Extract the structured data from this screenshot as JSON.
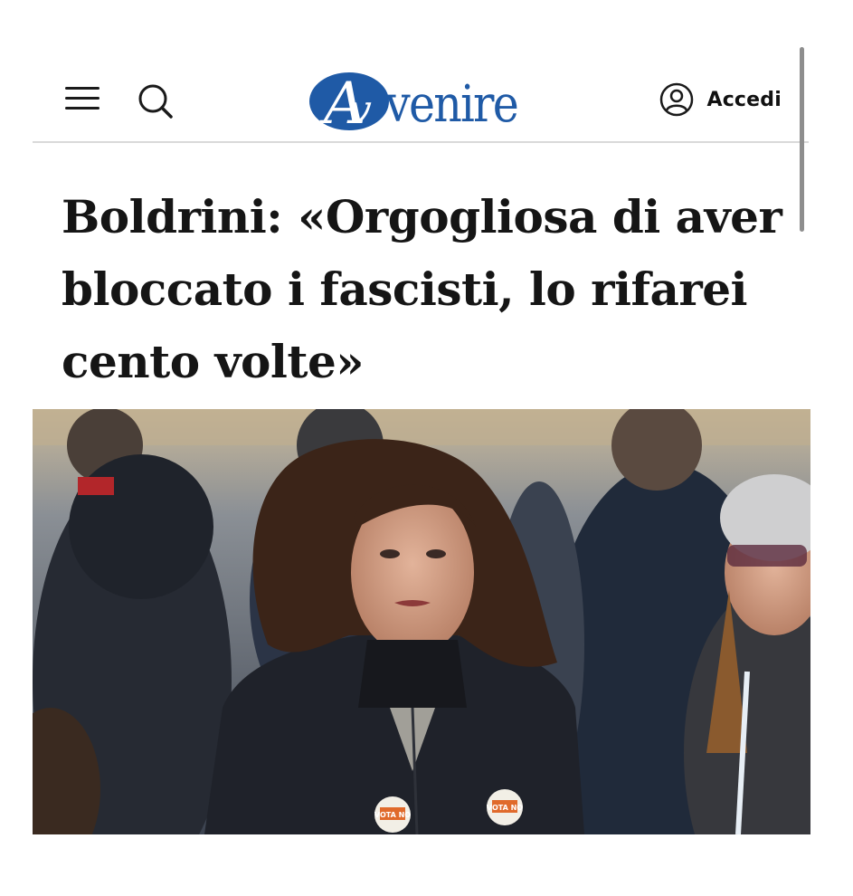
{
  "header": {
    "menu_icon": "hamburger-menu-icon",
    "search_icon": "search-icon",
    "logo_text": "Avvenire",
    "login_icon": "user-circle-icon",
    "login_label": "Accedi"
  },
  "article": {
    "headline": "Boldrini: «Orgogliosa di aver bloccato i fascisti, lo rifarei cento volte»"
  },
  "photo": {
    "badge_text_1": "VOTA NO",
    "badge_text_2": "VOTA NO"
  },
  "colors": {
    "brand": "#1f5aa6",
    "text": "#151515",
    "divider": "#d9d9d9"
  }
}
